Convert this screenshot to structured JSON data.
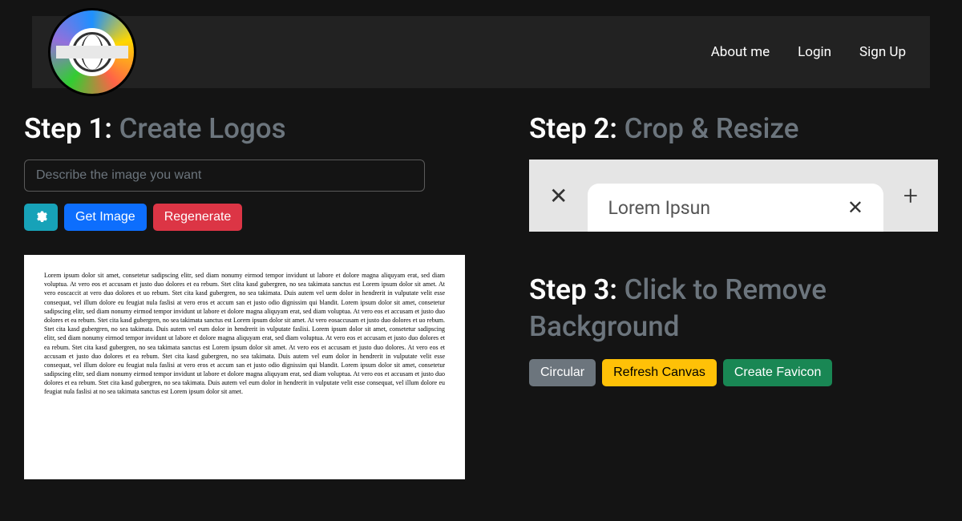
{
  "nav": {
    "about": "About me",
    "login": "Login",
    "signup": "Sign Up"
  },
  "step1": {
    "step_label": "Step 1:",
    "title": "Create Logos",
    "input_placeholder": "Describe the image you want",
    "btn_get": "Get Image",
    "btn_regen": "Regenerate"
  },
  "step2": {
    "step_label": "Step 2:",
    "title": "Crop & Resize",
    "tab_title": "Lorem Ipsun"
  },
  "step3": {
    "step_label": "Step 3:",
    "title": "Click to Remove Background",
    "btn_circular": "Circular",
    "btn_refresh": "Refresh Canvas",
    "btn_favicon": "Create Favicon"
  },
  "preview": {
    "lorem": "Lorem ipsum dolor sit amet, consetetur sadipscing elitr, sed diam nonumy eirmod tempor invidunt ut labore et dolore magna aliquyam erat, sed diam voluptua. At vero eos et accusam et justo duo dolores et ea rebum. Stet clita kasd gubergren, no sea takimata sanctus est Lorem ipsum dolor sit amet. At vero eoscaccit at vero duo dolores et uo rebum. Stet cita kasd gubergren, no sea takimata. Duis autem vel uem dolor in hendrerit in vulputate velit esse consequat, vel illum dolore eu feugiat nula faslisi at vero eros et accum san et justo odio dignissim qui blandit. Lorem ipsum dolor sit amet, consetetur sadipscing elitr, sed diam nonumy eirmod tempor invidunt ut labore et dolore magna aliquyam erat, sed diam voluptua. At vero eos et accusam et justo duo dolores et ea rebum. Stet cita kasd gubergren, no sea takimata sanctus est Lorem ipsum dolor sit amet. At vero eosaccusam et justo duo dolores et uo rebum. Stet cita kasd gubergren, no sea takimata. Duis autem vel eum dolor in hendrerit in vulputate faslisi. Lorem ipsum dolor sit amet, consetetur sadipscing elitr, sed diam nonumy eirmod tempor invidunt ut labore et dolore magna aliquyam erat, sed diam voluptua. At vero eos et accusam et justo duo dolores et ea rebum. Stet cita kasd gubergren, no sea takimata sanctus est Lorem ipsum dolor sit amet. At vero eos et accusam et justo duo dolores. At vero eos et accusam et justo duo dolores et ea rebum. Stet cita kasd gubergren, no sea takimata. Duis autem vel eum dolor in hendrerit in vulputate velit esse consequat, vel illum dolore eu feugiat nula faslisi at vero eros et accum san et justo odio dignissim qui blandit. Lorem ipsum dolor sit amet, consetetur sadipscing elitr, sed diam nonumy eirmod tempor invidunt ut labore et dolore magna aliquyam erat, sed diam voluptua. At vero eos et accusam et justo duo dolores et ea rebum. Stet cita kasd gubergren, no sea takimata. Duis autem vel eum dolor in hendrerit in vulputate velit esse consequat, vel illum dolore eu feugiat nula faslisi at no sea takimata sanctus est Lorem ipsum dolor sit amet."
  }
}
